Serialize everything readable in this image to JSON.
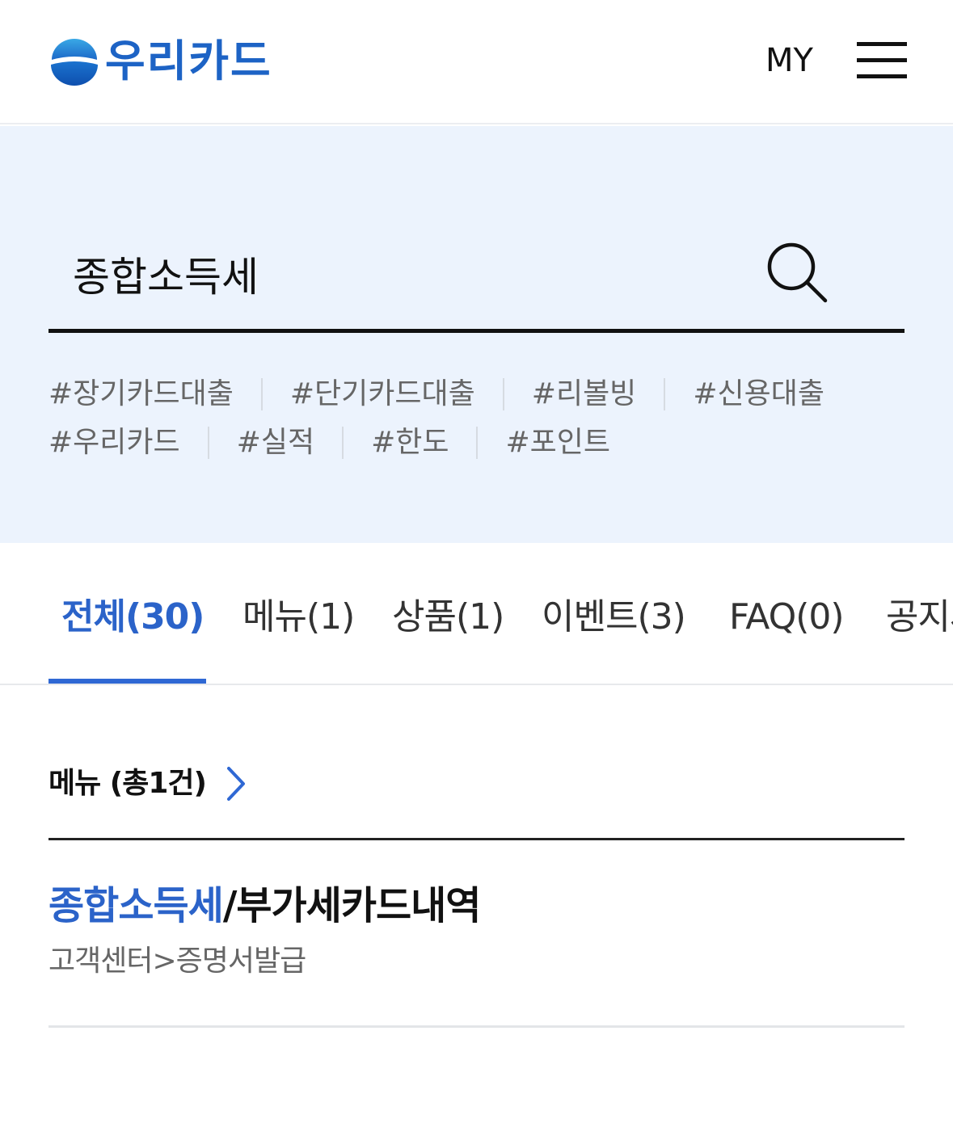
{
  "header": {
    "logo_text": "우리카드",
    "my_label": "MY",
    "brand_color": "#1d63c5"
  },
  "search": {
    "value": "종합소득세",
    "placeholder": "",
    "icon": "search-icon"
  },
  "hashtags": {
    "row1": [
      "#장기카드대출",
      "#단기카드대출",
      "#리볼빙",
      "#신용대출"
    ],
    "row2": [
      "#우리카드",
      "#실적",
      "#한도",
      "#포인트"
    ]
  },
  "tabs": [
    {
      "label": "전체(30)",
      "active": true
    },
    {
      "label": "메뉴(1)",
      "active": false
    },
    {
      "label": "상품(1)",
      "active": false
    },
    {
      "label": "이벤트(3)",
      "active": false
    },
    {
      "label": "FAQ(0)",
      "active": false
    },
    {
      "label": "공지사항",
      "active": false
    }
  ],
  "accent_color": "#2b63c9",
  "menu_section": {
    "title": "메뉴 (총1건)",
    "results": [
      {
        "title_highlight": "종합소득세",
        "title_rest": "/부가세카드내역",
        "path": "고객센터>증명서발급"
      }
    ]
  }
}
